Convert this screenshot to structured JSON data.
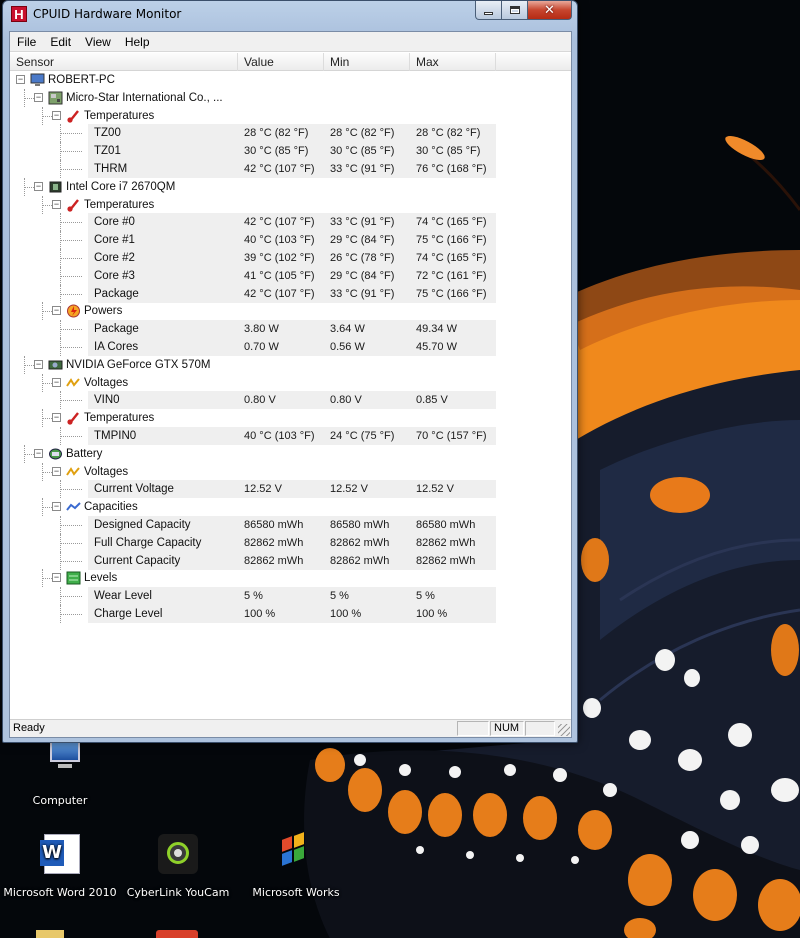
{
  "window": {
    "title": "CPUID Hardware Monitor",
    "icon_letter": "H",
    "status": "Ready",
    "status_num": "NUM"
  },
  "menu": [
    "File",
    "Edit",
    "View",
    "Help"
  ],
  "columns": [
    "Sensor",
    "Value",
    "Min",
    "Max"
  ],
  "tree": [
    {
      "level": 0,
      "label": "ROBERT-PC",
      "icon": "computer-icon",
      "expander": "-"
    },
    {
      "level": 1,
      "label": "Micro-Star International Co., ...",
      "icon": "motherboard-icon",
      "expander": "-"
    },
    {
      "level": 2,
      "label": "Temperatures",
      "icon": "thermometer-icon",
      "expander": "-"
    },
    {
      "level": 3,
      "label": "TZ00",
      "value": "28 °C  (82 °F)",
      "min": "28 °C  (82 °F)",
      "max": "28 °C  (82 °F)"
    },
    {
      "level": 3,
      "label": "TZ01",
      "value": "30 °C  (85 °F)",
      "min": "30 °C  (85 °F)",
      "max": "30 °C  (85 °F)"
    },
    {
      "level": 3,
      "label": "THRM",
      "value": "42 °C  (107 °F)",
      "min": "33 °C  (91 °F)",
      "max": "76 °C  (168 °F)"
    },
    {
      "level": 1,
      "label": "Intel Core i7 2670QM",
      "icon": "cpu-icon",
      "expander": "-"
    },
    {
      "level": 2,
      "label": "Temperatures",
      "icon": "thermometer-icon",
      "expander": "-"
    },
    {
      "level": 3,
      "label": "Core #0",
      "value": "42 °C  (107 °F)",
      "min": "33 °C  (91 °F)",
      "max": "74 °C  (165 °F)"
    },
    {
      "level": 3,
      "label": "Core #1",
      "value": "40 °C  (103 °F)",
      "min": "29 °C  (84 °F)",
      "max": "75 °C  (166 °F)"
    },
    {
      "level": 3,
      "label": "Core #2",
      "value": "39 °C  (102 °F)",
      "min": "26 °C  (78 °F)",
      "max": "74 °C  (165 °F)"
    },
    {
      "level": 3,
      "label": "Core #3",
      "value": "41 °C  (105 °F)",
      "min": "29 °C  (84 °F)",
      "max": "72 °C  (161 °F)"
    },
    {
      "level": 3,
      "label": "Package",
      "value": "42 °C  (107 °F)",
      "min": "33 °C  (91 °F)",
      "max": "75 °C  (166 °F)"
    },
    {
      "level": 2,
      "label": "Powers",
      "icon": "power-icon",
      "expander": "-"
    },
    {
      "level": 3,
      "label": "Package",
      "value": "3.80 W",
      "min": "3.64 W",
      "max": "49.34 W"
    },
    {
      "level": 3,
      "label": "IA Cores",
      "value": "0.70 W",
      "min": "0.56 W",
      "max": "45.70 W"
    },
    {
      "level": 1,
      "label": "NVIDIA GeForce GTX 570M",
      "icon": "gpu-icon",
      "expander": "-"
    },
    {
      "level": 2,
      "label": "Voltages",
      "icon": "voltage-icon",
      "expander": "-"
    },
    {
      "level": 3,
      "label": "VIN0",
      "value": "0.80 V",
      "min": "0.80 V",
      "max": "0.85 V"
    },
    {
      "level": 2,
      "label": "Temperatures",
      "icon": "thermometer-icon",
      "expander": "-"
    },
    {
      "level": 3,
      "label": "TMPIN0",
      "value": "40 °C  (103 °F)",
      "min": "24 °C  (75 °F)",
      "max": "70 °C  (157 °F)"
    },
    {
      "level": 1,
      "label": "Battery",
      "icon": "battery-icon",
      "expander": "-"
    },
    {
      "level": 2,
      "label": "Voltages",
      "icon": "voltage-icon",
      "expander": "-"
    },
    {
      "level": 3,
      "label": "Current Voltage",
      "value": "12.52 V",
      "min": "12.52 V",
      "max": "12.52 V"
    },
    {
      "level": 2,
      "label": "Capacities",
      "icon": "capacity-icon",
      "expander": "-"
    },
    {
      "level": 3,
      "label": "Designed Capacity",
      "value": "86580 mWh",
      "min": "86580 mWh",
      "max": "86580 mWh"
    },
    {
      "level": 3,
      "label": "Full Charge Capacity",
      "value": "82862 mWh",
      "min": "82862 mWh",
      "max": "82862 mWh"
    },
    {
      "level": 3,
      "label": "Current Capacity",
      "value": "82862 mWh",
      "min": "82862 mWh",
      "max": "82862 mWh"
    },
    {
      "level": 2,
      "label": "Levels",
      "icon": "levels-icon",
      "expander": "-"
    },
    {
      "level": 3,
      "label": "Wear Level",
      "value": "5 %",
      "min": "5 %",
      "max": "5 %"
    },
    {
      "level": 3,
      "label": "Charge Level",
      "value": "100 %",
      "min": "100 %",
      "max": "100 %"
    }
  ],
  "desktop_icons": [
    {
      "label": "Computer",
      "icon": "computer-desktop-icon"
    },
    {
      "label": "Microsoft Word 2010",
      "icon": "word-icon"
    },
    {
      "label": "CyberLink YouCam",
      "icon": "webcam-icon"
    },
    {
      "label": "Microsoft Works",
      "icon": "works-icon"
    }
  ],
  "colors": {
    "butterfly_orange": "#f28a1c",
    "butterfly_dark": "#141a2a",
    "shade_row": "#efefef",
    "close_red": "#c7452e"
  }
}
